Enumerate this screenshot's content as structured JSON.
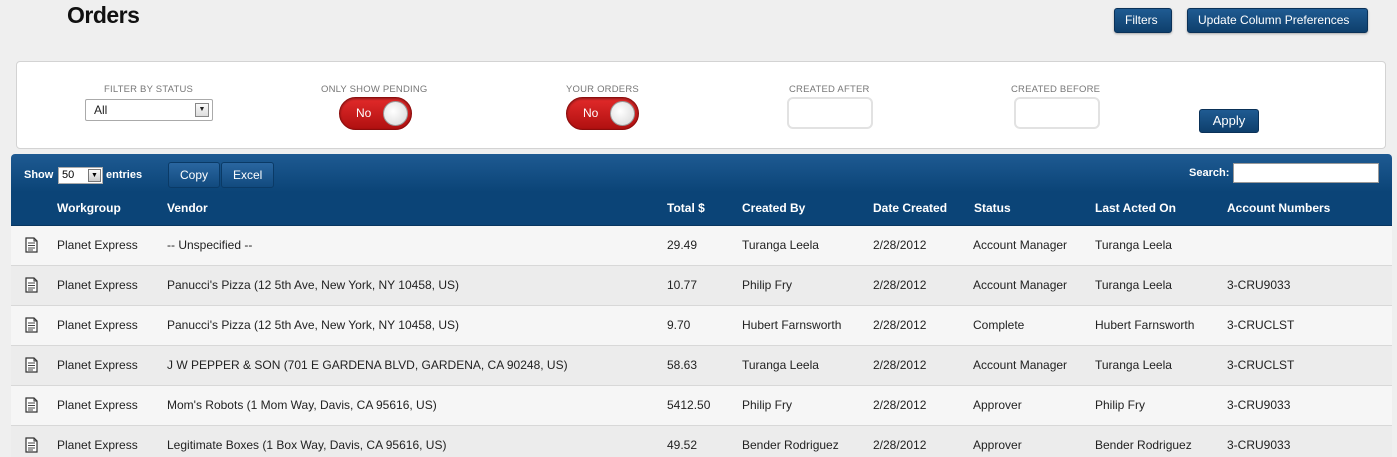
{
  "page": {
    "title": "Orders"
  },
  "header_buttons": {
    "filters": "Filters",
    "update_columns": "Update Column Preferences"
  },
  "filter_panel": {
    "status_label": "FILTER BY STATUS",
    "status_value": "All",
    "pending_label": "ONLY SHOW PENDING",
    "pending_value": "No",
    "your_orders_label": "YOUR ORDERS",
    "your_orders_value": "No",
    "created_after_label": "CREATED AFTER",
    "created_after_value": "",
    "created_before_label": "CREATED BEFORE",
    "created_before_value": "",
    "apply_label": "Apply",
    "toggle_color": "#c81a1a"
  },
  "table_toolbar": {
    "show_label": "Show",
    "entries_value": "50",
    "entries_label": "entries",
    "copy_label": "Copy",
    "excel_label": "Excel",
    "search_label": "Search:",
    "search_value": ""
  },
  "table": {
    "columns": [
      "Workgroup",
      "Vendor",
      "Total $",
      "Created By",
      "Date Created",
      "Status",
      "Last Acted On",
      "Account Numbers"
    ],
    "rows": [
      {
        "workgroup": "Planet Express",
        "vendor": "-- Unspecified --",
        "total": "29.49",
        "created_by": "Turanga Leela",
        "date": "2/28/2012",
        "status": "Account Manager",
        "last_acted": "Turanga Leela",
        "account": ""
      },
      {
        "workgroup": "Planet Express",
        "vendor": "Panucci's Pizza (12 5th Ave, New York, NY 10458, US)",
        "total": "10.77",
        "created_by": "Philip Fry",
        "date": "2/28/2012",
        "status": "Account Manager",
        "last_acted": "Turanga Leela",
        "account": "3-CRU9033"
      },
      {
        "workgroup": "Planet Express",
        "vendor": "Panucci's Pizza (12 5th Ave, New York, NY 10458, US)",
        "total": "9.70",
        "created_by": "Hubert Farnsworth",
        "date": "2/28/2012",
        "status": "Complete",
        "last_acted": "Hubert Farnsworth",
        "account": "3-CRUCLST"
      },
      {
        "workgroup": "Planet Express",
        "vendor": "J W PEPPER & SON (701 E GARDENA BLVD, GARDENA, CA 90248, US)",
        "total": "58.63",
        "created_by": "Turanga Leela",
        "date": "2/28/2012",
        "status": "Account Manager",
        "last_acted": "Turanga Leela",
        "account": "3-CRUCLST"
      },
      {
        "workgroup": "Planet Express",
        "vendor": "Mom's Robots (1 Mom Way, Davis, CA 95616, US)",
        "total": "5412.50",
        "created_by": "Philip Fry",
        "date": "2/28/2012",
        "status": "Approver",
        "last_acted": "Philip Fry",
        "account": "3-CRU9033"
      },
      {
        "workgroup": "Planet Express",
        "vendor": "Legitimate Boxes (1 Box Way, Davis, CA 95616, US)",
        "total": "49.52",
        "created_by": "Bender Rodriguez",
        "date": "2/28/2012",
        "status": "Approver",
        "last_acted": "Bender Rodriguez",
        "account": "3-CRU9033"
      }
    ]
  },
  "icons": {
    "row_icon": "document-icon",
    "select_arrow": "chevron-down-icon"
  },
  "colors": {
    "header_blue": "#0b4477",
    "button_blue": "#124a7e"
  }
}
